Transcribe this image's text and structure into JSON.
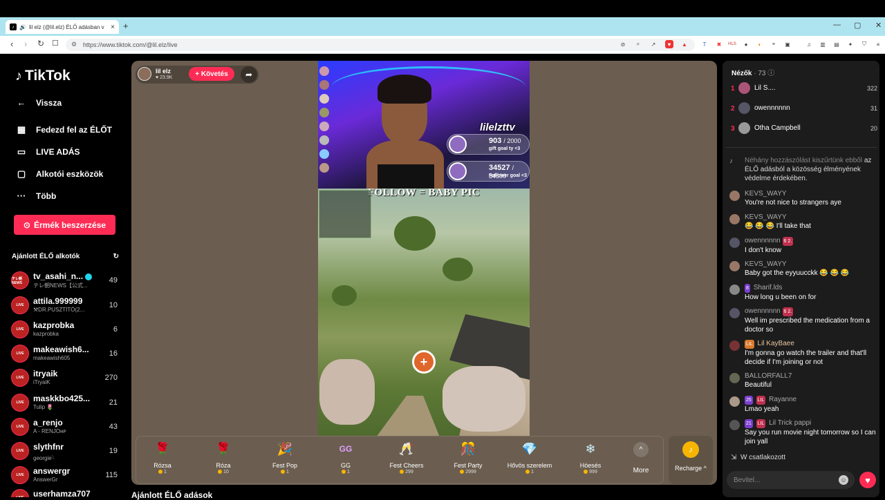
{
  "browser": {
    "tab_title": "lil elz (@lil.elz) ÉLŐ adásban v",
    "url": "https://www.tiktok.com/@lil.elz/live"
  },
  "sidebar": {
    "logo": "TikTok",
    "back": "Vissza",
    "nav": [
      "Fedezd fel az ÉLŐT",
      "LIVE ADÁS",
      "Alkotói eszközök",
      "Több"
    ],
    "coins_button": "Érmék beszerzése",
    "recommended_title": "Ajánlott ÉLŐ alkotók",
    "creators": [
      {
        "name": "tv_asahi_n...",
        "sub": "テレ朝NEWS【公式...",
        "count": "49",
        "avatar": "テレ朝 NEWS"
      },
      {
        "name": "attila.999999",
        "sub": "⚒DR.PUSZTÍTÓ(2...",
        "count": "10",
        "avatar": "LIVE"
      },
      {
        "name": "kazprobka",
        "sub": "kazprobka",
        "count": "6",
        "avatar": "LIVE"
      },
      {
        "name": "makeawish6...",
        "sub": "makeawish605",
        "count": "16",
        "avatar": "LIVE"
      },
      {
        "name": "itryaik",
        "sub": "iTryaiK",
        "count": "270",
        "avatar": "LIVE"
      },
      {
        "name": "maskkbo425...",
        "sub": "Tulip 🌷",
        "count": "21",
        "avatar": "LIVE"
      },
      {
        "name": "a_renjo",
        "sub": "A - RENJOʜᴘ",
        "count": "43",
        "avatar": "LIVE"
      },
      {
        "name": "slythfnr",
        "sub": "georgie𓆩",
        "count": "19",
        "avatar": "LIVE"
      },
      {
        "name": "answergr",
        "sub": "AnswerGr",
        "count": "115",
        "avatar": "LIVE"
      },
      {
        "name": "userhamza707",
        "sub": "",
        "count": "",
        "avatar": "LIVE"
      }
    ]
  },
  "stream": {
    "host_name": "lil elz",
    "host_likes": "23.9K",
    "follow_label": "+ Követés",
    "overlay_brand": "lilelzttv",
    "gift_goal": {
      "current": "903",
      "target": "/ 2000",
      "label": "gift goal ty <3"
    },
    "follower_goal": {
      "current": "34527",
      "target": "/ 34500",
      "label": "Follower goal <3"
    },
    "banner": "FOLLOW = BABY PIC",
    "below_title": "Ajánlott ÉLŐ adások"
  },
  "gifts": [
    {
      "name": "Rózsa",
      "price": "1",
      "icon": "🌹",
      "color": "#e0355e"
    },
    {
      "name": "Róza",
      "price": "10",
      "icon": "🌹",
      "color": "#c8102e"
    },
    {
      "name": "Fest Pop",
      "price": "1",
      "icon": "🎉",
      "color": "#7a4bd6"
    },
    {
      "name": "GG",
      "price": "1",
      "icon": "GG",
      "color": "#b05bd8"
    },
    {
      "name": "Fest Cheers",
      "price": "299",
      "icon": "🥂",
      "color": "#3aa0e0"
    },
    {
      "name": "Fest Party",
      "price": "2999",
      "icon": "🎊",
      "color": "#d04aa0"
    },
    {
      "name": "Hővös szerelem",
      "price": "1",
      "icon": "💎",
      "color": "#a6e3f0"
    },
    {
      "name": "Hóesés",
      "price": "999",
      "icon": "❄",
      "color": "#9fd6ea"
    }
  ],
  "more_label": "More",
  "recharge_label": "Recharge ^",
  "viewers": {
    "title": "Nézők",
    "count": "· 73",
    "top": [
      {
        "rank": "1",
        "name": "Lil S....",
        "score": "322"
      },
      {
        "rank": "2",
        "name": "owennnnnn",
        "score": "31"
      },
      {
        "rank": "3",
        "name": "Otha Campbell",
        "score": "20"
      }
    ]
  },
  "chat": [
    {
      "user": "Néhány hozzászólást kiszűrtünk ebből az ÉLŐ adásból a közösség élményének védelme érdekében.",
      "text": "",
      "badge": ""
    },
    {
      "user": "KEVS_WAYY",
      "text": "You're not nice to strangers aye",
      "badge": ""
    },
    {
      "user": "KEVS_WAYY",
      "text": "😂 😂 😂 I'll take that",
      "badge": ""
    },
    {
      "user": "owennnnnn",
      "text": "I don't know",
      "badge": "2"
    },
    {
      "user": "KEVS_WAYY",
      "text": "Baby got the eyyuucckk 😂 😂 😂",
      "badge": ""
    },
    {
      "user": "Sharif.lds",
      "text": "How long u been on for",
      "badge": "8"
    },
    {
      "user": "owennnnnn",
      "text": "Well im prescribed the medication from a doctor so",
      "badge": "2"
    },
    {
      "user": "Lil KayBaee",
      "text": "I'm gonna go watch the trailer and that'll decide if I'm joining or not",
      "badge": "LIL"
    },
    {
      "user": "BALLORFALL7",
      "text": "Beautiful",
      "badge": ""
    },
    {
      "user": "Rayanne",
      "text": "Lmao yeah",
      "badge": "25"
    },
    {
      "user": "Lil Trick pappi",
      "text": "Say you run movie night tomorrow so I can join yall",
      "badge": "21"
    }
  ],
  "joined": "W  csatlakozott",
  "input_placeholder": "Bevitel..."
}
